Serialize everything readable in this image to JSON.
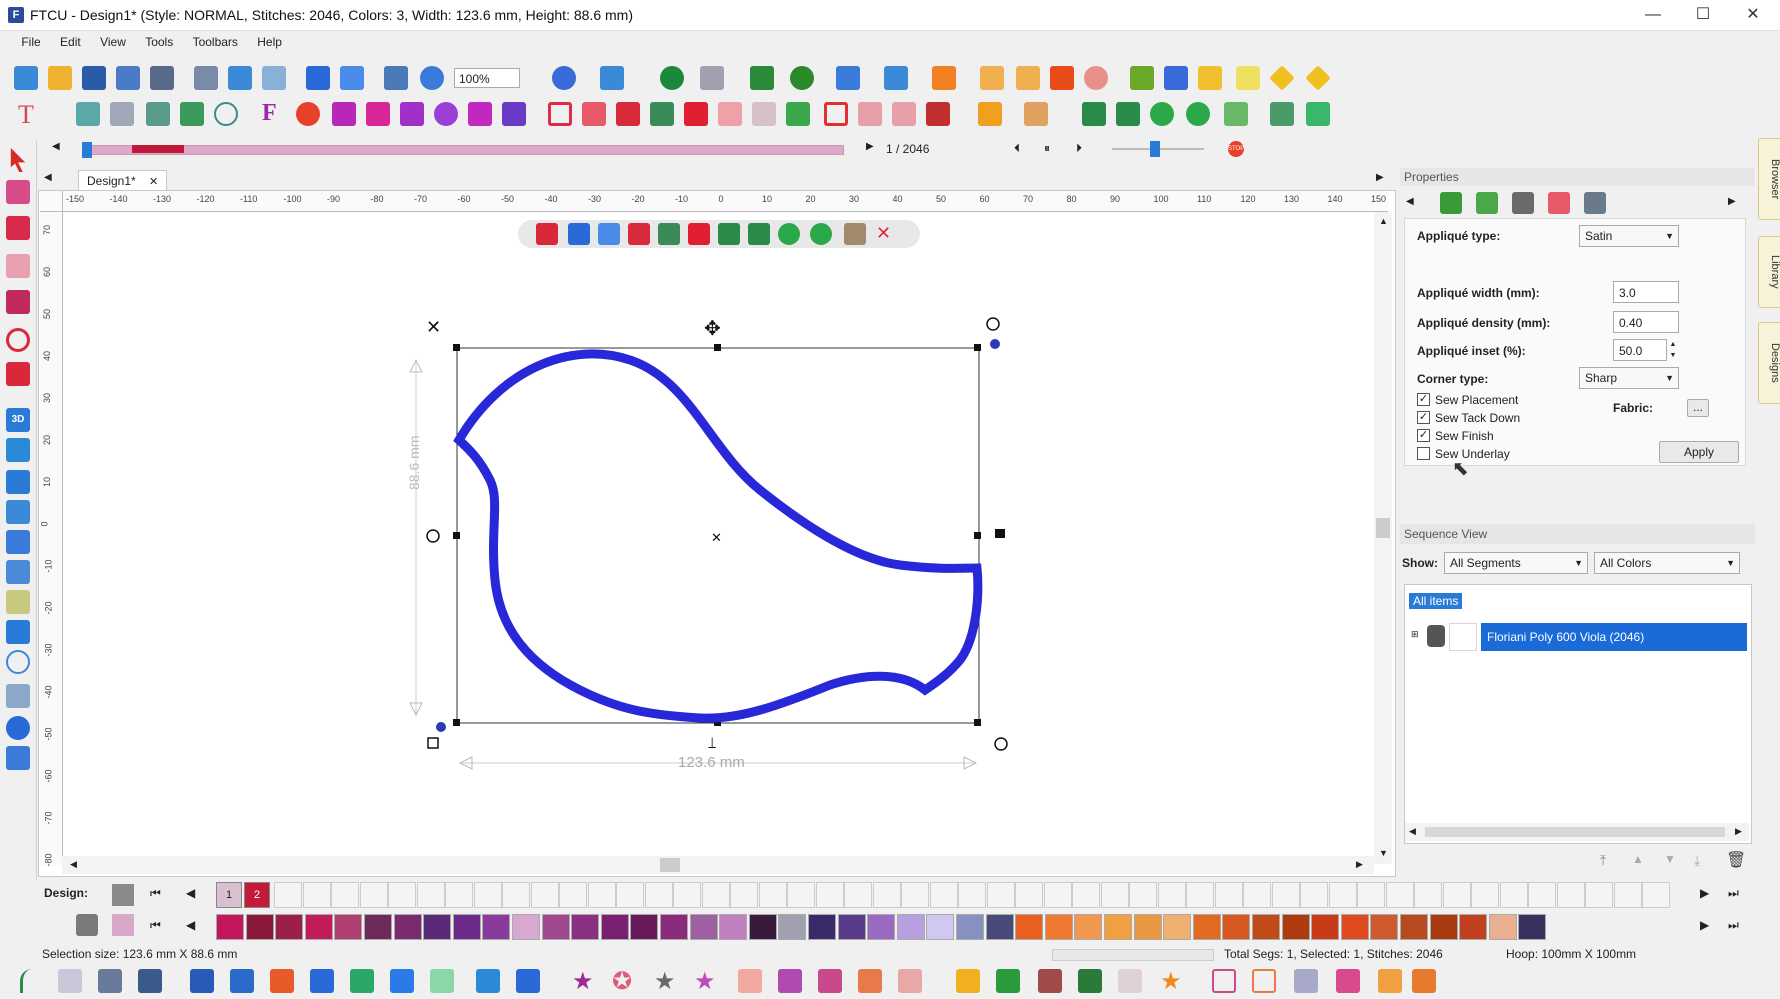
{
  "window": {
    "title": "FTCU - Design1* (Style: NORMAL, Stitches: 2046, Colors: 3, Width: 123.6 mm, Height: 88.6 mm)",
    "minimize": "—",
    "maximize": "☐",
    "close": "✕",
    "app_icon": "F"
  },
  "menubar": [
    "File",
    "Edit",
    "View",
    "Tools",
    "Toolbars",
    "Help"
  ],
  "toolbar": {
    "zoom_value": "100%"
  },
  "playback": {
    "counter": "1 / 2046",
    "position": 0.0005
  },
  "tabs": {
    "doc_tab": "Design1*",
    "doc_close": "✕"
  },
  "ruler": {
    "h_labels": [
      "-150",
      "-140",
      "-130",
      "-120",
      "-110",
      "-100",
      "-90",
      "-80",
      "-70",
      "-60",
      "-50",
      "-40",
      "-30",
      "-20",
      "-10",
      "0",
      "10",
      "20",
      "30",
      "40",
      "50",
      "60",
      "70",
      "80",
      "90",
      "100",
      "110",
      "120",
      "130",
      "140",
      "150"
    ],
    "v_labels": [
      "70",
      "60",
      "50",
      "40",
      "30",
      "20",
      "10",
      "0",
      "-10",
      "-20",
      "-30",
      "-40",
      "-50",
      "-60",
      "-70",
      "-80"
    ]
  },
  "canvas": {
    "width_label": "123.6 mm",
    "height_label": "88.6 mm",
    "design_color": "#2828d8"
  },
  "properties": {
    "title": "Properties",
    "applique_type_label": "Appliqué type:",
    "applique_type_value": "Satin",
    "width_label": "Appliqué width (mm):",
    "width_value": "3.0",
    "density_label": "Appliqué density (mm):",
    "density_value": "0.40",
    "inset_label": "Appliqué inset (%):",
    "inset_value": "50.0",
    "corner_label": "Corner type:",
    "corner_value": "Sharp",
    "fabric_label": "Fabric:",
    "fabric_btn": "...",
    "checks": [
      {
        "label": "Sew Placement",
        "checked": true
      },
      {
        "label": "Sew Tack Down",
        "checked": true
      },
      {
        "label": "Sew Finish",
        "checked": true
      },
      {
        "label": "Sew Underlay",
        "checked": false
      }
    ],
    "apply": "Apply"
  },
  "sequence": {
    "title": "Sequence View",
    "show_label": "Show:",
    "show_value": "All Segments",
    "colors_value": "All Colors",
    "all_items": "All items",
    "item_label": "Floriani Poly 600 Viola (2046)"
  },
  "side_tabs": [
    "Browser",
    "Library",
    "Designs"
  ],
  "colorbar": {
    "design_label": "Design:",
    "design_slots": [
      "1",
      "2"
    ],
    "palette": [
      "#c2185b",
      "#8b1a3a",
      "#9c1f4a",
      "#c21d5a",
      "#b04070",
      "#6e2a5a",
      "#7a2a6e",
      "#5a2a7a",
      "#6a2a8a",
      "#8a3a9a",
      "#d8a8d0",
      "#a04890",
      "#8a3080",
      "#7a2070",
      "#6a1a5a",
      "#8a2a7a",
      "#a060a0",
      "#c080c0",
      "#3a1a3a",
      "#a0a0b0",
      "#3a2a6a",
      "#5a3a8a",
      "#9a6ac0",
      "#b8a0e0",
      "#d0c8f0",
      "#8890c0",
      "#4a4a7a",
      "#e86020",
      "#f07830",
      "#f09850",
      "#f0a040",
      "#e89840",
      "#f0b070",
      "#e06a20",
      "#d85a20",
      "#c04a18",
      "#b03a10",
      "#c83a18",
      "#e04a20",
      "#d05a30",
      "#b84a20",
      "#a83a10",
      "#c04020",
      "#e8b090",
      "#3a3060"
    ]
  },
  "status": {
    "selection": "Selection size: 123.6 mm X 88.6 mm",
    "segs": "Total Segs: 1, Selected: 1, Stitches: 2046",
    "hoop": "Hoop: 100mm X 100mm"
  }
}
